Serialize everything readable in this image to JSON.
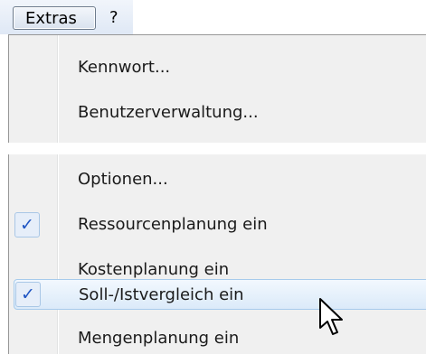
{
  "menubar": {
    "items": [
      {
        "label": "Extras",
        "active": true
      },
      {
        "label": "?"
      }
    ]
  },
  "menu": {
    "items": [
      {
        "label": "Kennwort...",
        "checked": false
      },
      {
        "label": "Benutzerverwaltung...",
        "checked": false
      },
      {
        "label": "Optionen...",
        "checked": false
      },
      {
        "label": "Ressourcenplanung ein",
        "checked": true
      },
      {
        "label": "Kostenplanung ein",
        "checked": false
      },
      {
        "label": "Soll-/Istvergleich ein",
        "checked": true,
        "highlighted": true
      },
      {
        "label": "Mengenplanung ein",
        "checked": false
      }
    ],
    "check_glyph": "✓"
  },
  "colors": {
    "accent_check": "#1f55c3",
    "highlight_border": "#a7cbec",
    "menu_background": "#f0f0f0"
  },
  "cursor": {
    "icon": "arrow-pointer-icon"
  }
}
